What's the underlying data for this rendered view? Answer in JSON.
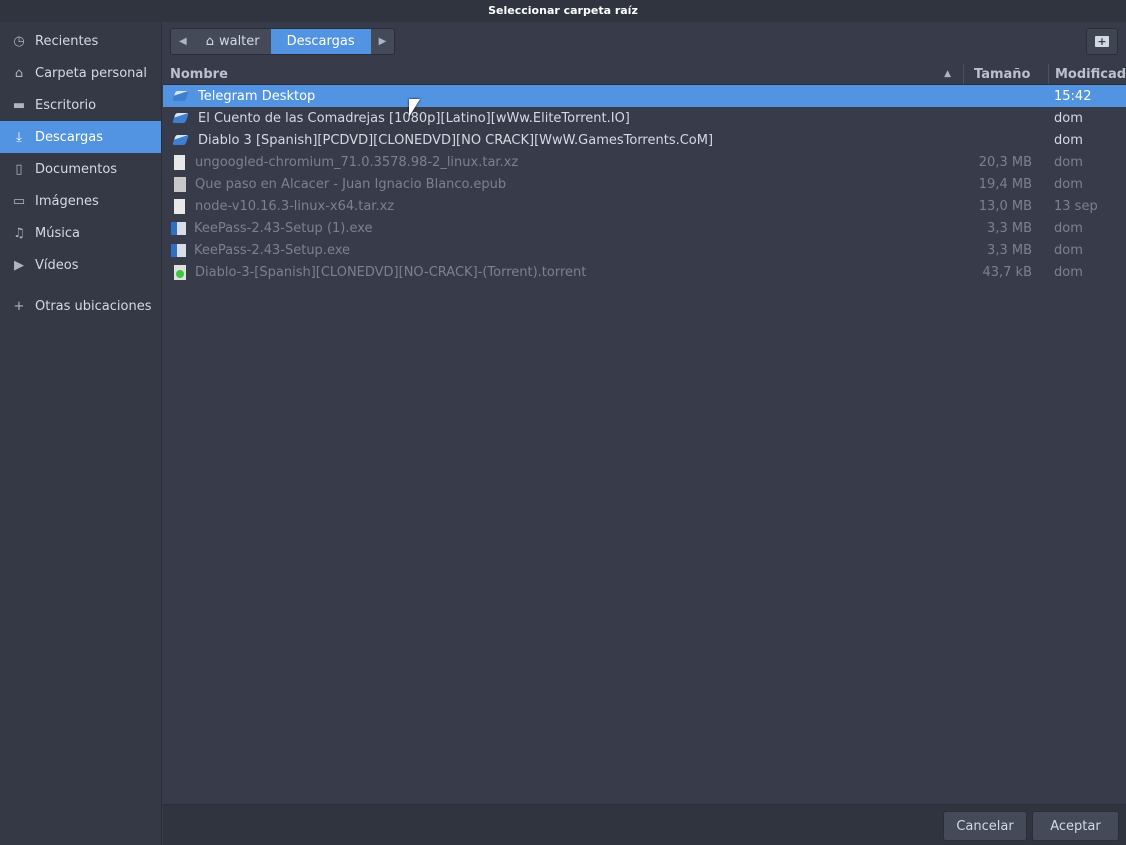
{
  "window": {
    "title": "Seleccionar carpeta raíz"
  },
  "sidebar": {
    "items": [
      {
        "label": "Recientes",
        "icon": "clock-icon",
        "glyph": "◷"
      },
      {
        "label": "Carpeta personal",
        "icon": "home-icon",
        "glyph": "⌂"
      },
      {
        "label": "Escritorio",
        "icon": "desktop-icon",
        "glyph": "▬"
      },
      {
        "label": "Descargas",
        "icon": "download-icon",
        "glyph": "⤓",
        "active": true
      },
      {
        "label": "Documentos",
        "icon": "document-icon",
        "glyph": "▯"
      },
      {
        "label": "Imágenes",
        "icon": "image-icon",
        "glyph": "▭"
      },
      {
        "label": "Música",
        "icon": "music-icon",
        "glyph": "♫"
      },
      {
        "label": "Vídeos",
        "icon": "video-icon",
        "glyph": "▶"
      },
      {
        "label": "Otras ubicaciones",
        "icon": "plus-icon",
        "glyph": "+"
      }
    ]
  },
  "pathbar": {
    "back": "◀",
    "home": "walter",
    "current": "Descargas",
    "forward": "▶"
  },
  "columns": {
    "name": "Nombre",
    "size": "Tamaño",
    "modified": "Modificado"
  },
  "files": [
    {
      "name": "Telegram Desktop",
      "size": "",
      "modified": "15:42",
      "type": "folder"
    },
    {
      "name": "El Cuento de las Comadrejas [1080p][Latino][wWw.EliteTorrent.IO]",
      "size": "",
      "modified": "dom",
      "type": "folder"
    },
    {
      "name": "Diablo 3 [Spanish][PCDVD][CLONEDVD][NO CRACK][WwW.GamesTorrents.CoM]",
      "size": "",
      "modified": "dom",
      "type": "folder"
    },
    {
      "name": "ungoogled-chromium_71.0.3578.98-2_linux.tar.xz",
      "size": "20,3 MB",
      "modified": "dom",
      "type": "arch"
    },
    {
      "name": "Que paso en Alcacer - Juan Ignacio Blanco.epub",
      "size": "19,4 MB",
      "modified": "dom",
      "type": "doc"
    },
    {
      "name": "node-v10.16.3-linux-x64.tar.xz",
      "size": "13,0 MB",
      "modified": "13 sep",
      "type": "arch"
    },
    {
      "name": "KeePass-2.43-Setup (1).exe",
      "size": "3,3 MB",
      "modified": "dom",
      "type": "exe"
    },
    {
      "name": "KeePass-2.43-Setup.exe",
      "size": "3,3 MB",
      "modified": "dom",
      "type": "exe"
    },
    {
      "name": "Diablo-3-[Spanish][CLONEDVD][NO-CRACK]-(Torrent).torrent",
      "size": "43,7 kB",
      "modified": "dom",
      "type": "tor"
    }
  ],
  "footer": {
    "cancel": "Cancelar",
    "accept": "Aceptar"
  }
}
